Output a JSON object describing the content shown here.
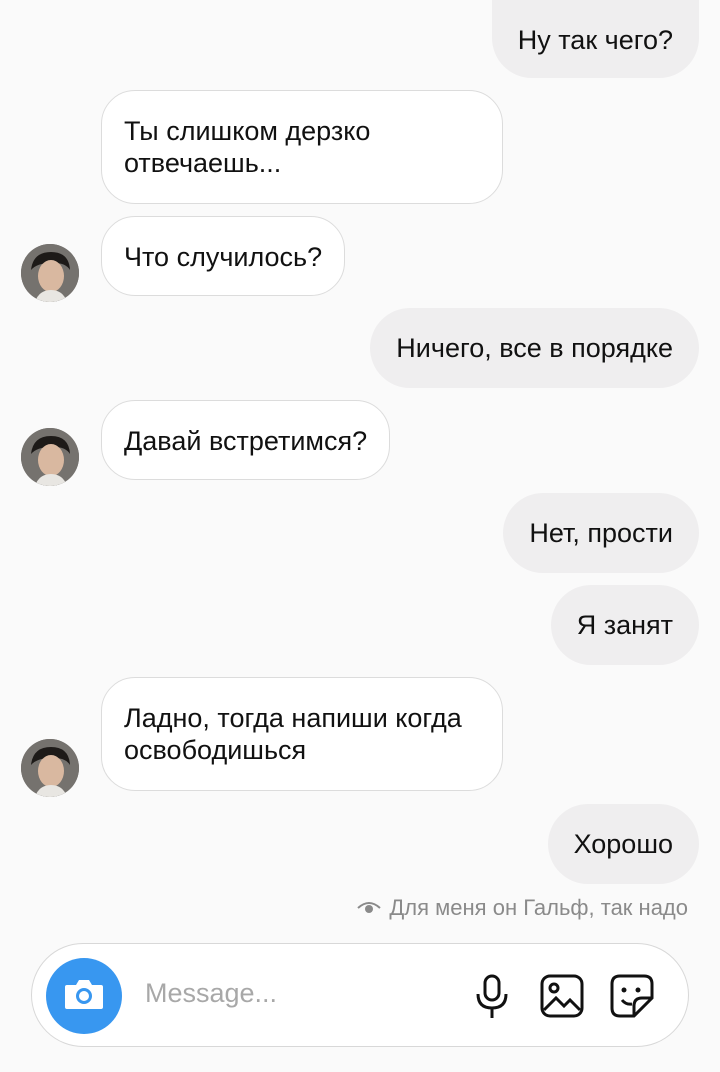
{
  "messages": [
    {
      "id": "m1",
      "side": "out",
      "text": "Ну так чего?"
    },
    {
      "id": "m2",
      "side": "in",
      "text": "Ты слишком дерзко отвечаешь..."
    },
    {
      "id": "m3",
      "side": "in",
      "text": "Что случилось?"
    },
    {
      "id": "m4",
      "side": "out",
      "text": "Ничего, все в порядке"
    },
    {
      "id": "m5",
      "side": "in",
      "text": "Давай встретимся?"
    },
    {
      "id": "m6",
      "side": "out",
      "text": "Нет, прости"
    },
    {
      "id": "m7",
      "side": "out",
      "text": "Я занят"
    },
    {
      "id": "m8",
      "side": "in",
      "text": "Ладно, тогда напиши когда освободишься"
    },
    {
      "id": "m9",
      "side": "out",
      "text": "Хорошо"
    }
  ],
  "seen_status": "Для меня он Гальф, так надо",
  "composer": {
    "placeholder": "Message...",
    "icons": [
      "camera-icon",
      "microphone-icon",
      "gallery-icon",
      "sticker-icon"
    ]
  },
  "colors": {
    "accent": "#3897f0",
    "outgoing_bubble": "#efeeef",
    "incoming_border": "#dcdcdc",
    "muted_text": "#8a8a8a"
  }
}
